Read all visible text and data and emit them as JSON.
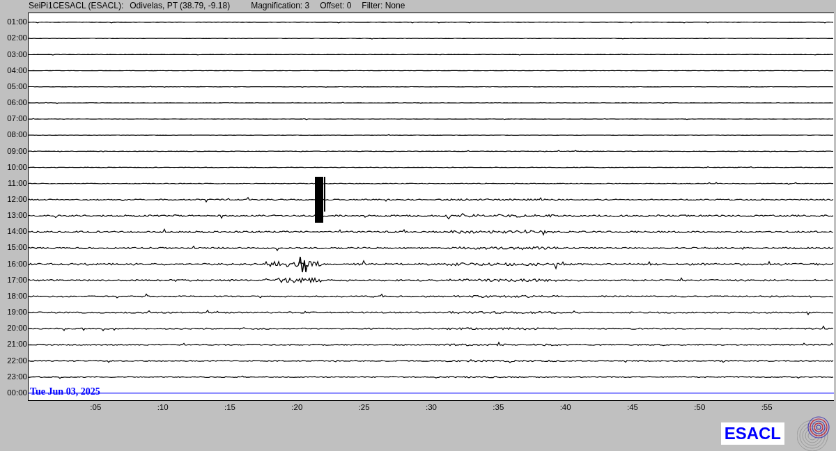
{
  "header": {
    "station": "SeiPi1CESACL (ESACL):",
    "location": "Odivelas, PT (38.79, -9.18)",
    "magnification": "Magnification: 3",
    "offset": "Offset: 0",
    "filter": "Filter: None"
  },
  "hours": [
    "01:00",
    "02:00",
    "03:00",
    "04:00",
    "05:00",
    "06:00",
    "07:00",
    "08:00",
    "09:00",
    "10:00",
    "11:00",
    "12:00",
    "13:00",
    "14:00",
    "15:00",
    "16:00",
    "17:00",
    "18:00",
    "19:00",
    "20:00",
    "21:00",
    "22:00",
    "23:00",
    "00:00"
  ],
  "date_label": "Tue Jun 03, 2025",
  "minute_ticks": [
    ":05",
    ":10",
    ":15",
    ":20",
    ":25",
    ":30",
    ":35",
    ":40",
    ":45",
    ":50",
    ":55"
  ],
  "logo": "ESACL"
}
